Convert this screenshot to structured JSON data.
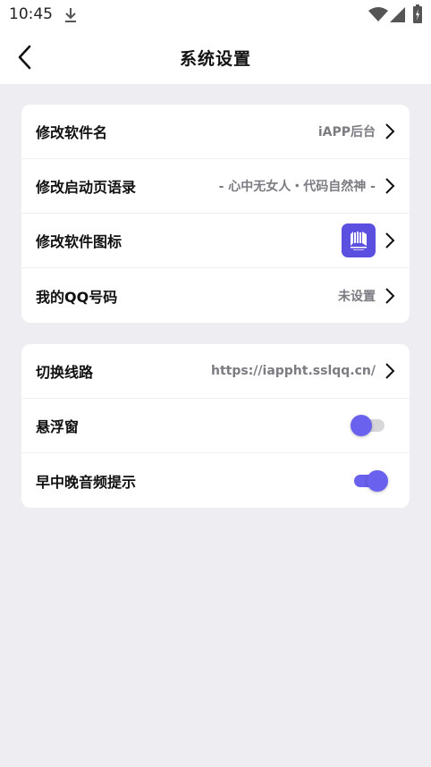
{
  "status_bar": {
    "time": "10:45",
    "icons": [
      "download-icon",
      "wifi-icon",
      "signal-icon",
      "battery-icon"
    ]
  },
  "header": {
    "title": "系统设置",
    "back_icon": "back-arrow-icon"
  },
  "card1": {
    "rows": [
      {
        "label": "修改软件名",
        "value": "iAPP后台"
      },
      {
        "label": "修改启动页语录",
        "value": "- 心中无女人・代码自然神 -"
      },
      {
        "label": "修改软件图标",
        "value": ""
      },
      {
        "label": "我的QQ号码",
        "value": "未设置"
      }
    ]
  },
  "card2": {
    "rows": [
      {
        "label": "切换线路",
        "value": "https://iappht.sslqq.cn/"
      },
      {
        "label": "悬浮窗",
        "toggle": false
      },
      {
        "label": "早中晚音频提示",
        "toggle": true
      }
    ]
  },
  "colors": {
    "accent": "#6a62ee",
    "app_icon_bg": "#5b4fe0",
    "page_bg": "#eeedf2",
    "value_text": "#7b7b82"
  }
}
